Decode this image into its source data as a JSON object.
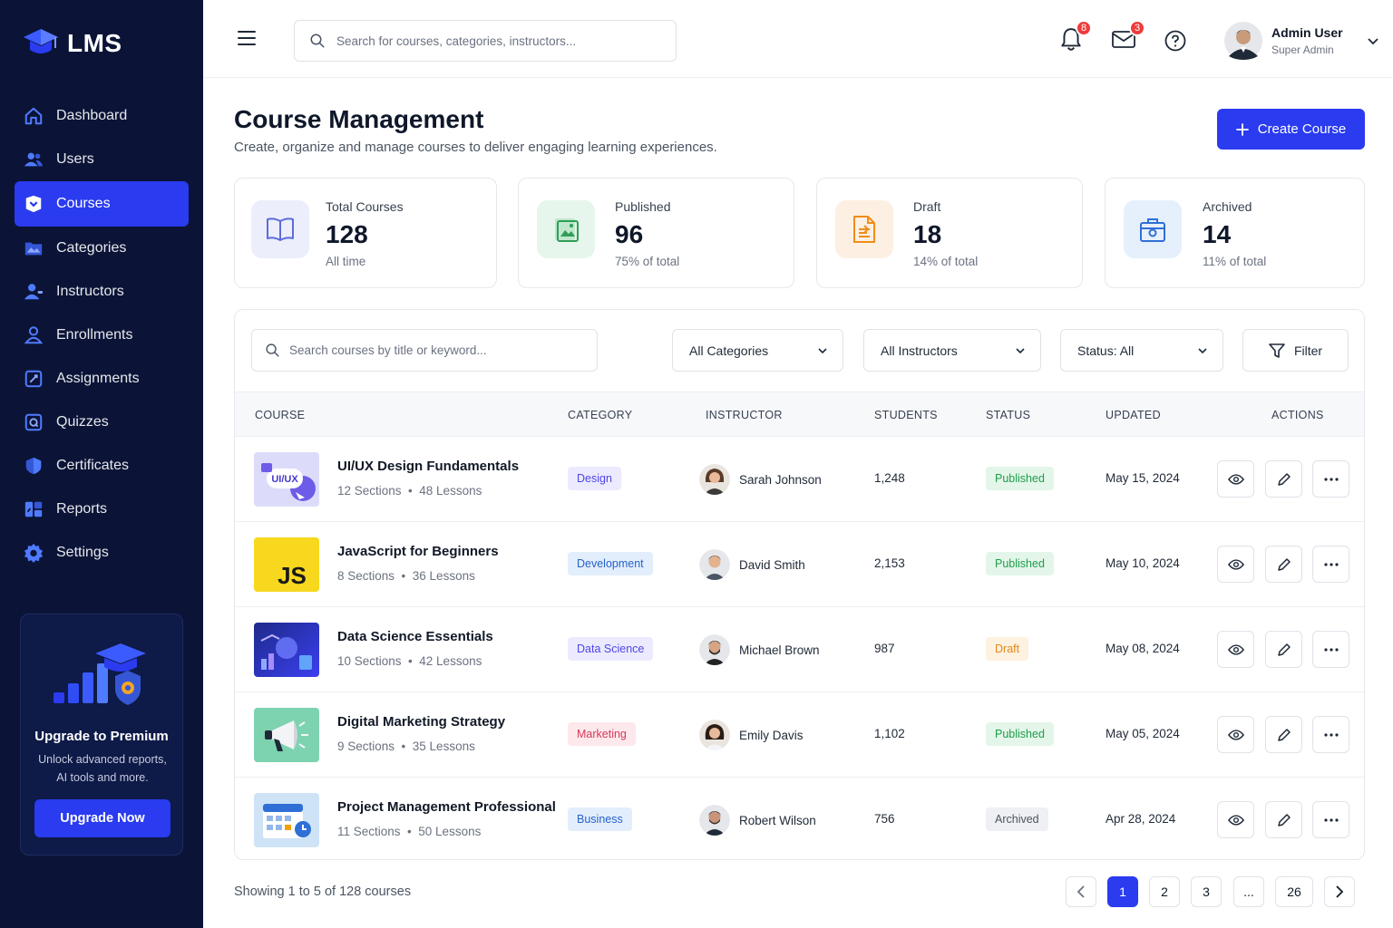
{
  "brand": {
    "name": "LMS"
  },
  "sidebar": {
    "items": [
      {
        "label": "Dashboard",
        "icon": "home-icon"
      },
      {
        "label": "Users",
        "icon": "users-icon"
      },
      {
        "label": "Courses",
        "icon": "courses-icon",
        "active": true
      },
      {
        "label": "Categories",
        "icon": "categories-icon"
      },
      {
        "label": "Instructors",
        "icon": "instructor-icon"
      },
      {
        "label": "Enrollments",
        "icon": "enrollment-icon"
      },
      {
        "label": "Assignments",
        "icon": "assignment-icon"
      },
      {
        "label": "Quizzes",
        "icon": "quiz-icon"
      },
      {
        "label": "Certificates",
        "icon": "certificate-icon"
      },
      {
        "label": "Reports",
        "icon": "reports-icon"
      },
      {
        "label": "Settings",
        "icon": "gear-icon"
      }
    ],
    "promo": {
      "title": "Upgrade to Premium",
      "description": "Unlock advanced reports, AI tools and more.",
      "button": "Upgrade Now"
    }
  },
  "header": {
    "search_placeholder": "Search for courses, categories, instructors...",
    "notifications_count": "8",
    "messages_count": "3",
    "user": {
      "name": "Admin User",
      "role": "Super Admin"
    }
  },
  "page": {
    "title": "Course Management",
    "subtitle": "Create, organize and manage courses to deliver engaging learning experiences.",
    "create_button": "Create Course"
  },
  "stats": [
    {
      "label": "Total Courses",
      "value": "128",
      "note": "All time"
    },
    {
      "label": "Published",
      "value": "96",
      "note": "75% of total"
    },
    {
      "label": "Draft",
      "value": "18",
      "note": "14% of total"
    },
    {
      "label": "Archived",
      "value": "14",
      "note": "11% of total"
    }
  ],
  "filters": {
    "search_placeholder": "Search courses by title or keyword...",
    "category": "All Categories",
    "instructor": "All Instructors",
    "status": "Status: All",
    "filter_button": "Filter"
  },
  "table": {
    "columns": [
      "COURSE",
      "CATEGORY",
      "INSTRUCTOR",
      "STUDENTS",
      "STATUS",
      "UPDATED",
      "ACTIONS"
    ],
    "rows": [
      {
        "title": "UI/UX Design Fundamentals",
        "sections": "12 Sections",
        "lessons": "48 Lessons",
        "category": "Design",
        "instructor": "Sarah Johnson",
        "students": "1,248",
        "status": "Published",
        "updated": "May 15, 2024",
        "thumb_label": "UI/UX"
      },
      {
        "title": "JavaScript for Beginners",
        "sections": "8 Sections",
        "lessons": "36 Lessons",
        "category": "Development",
        "instructor": "David Smith",
        "students": "2,153",
        "status": "Published",
        "updated": "May 10, 2024",
        "thumb_label": "JS"
      },
      {
        "title": "Data Science Essentials",
        "sections": "10 Sections",
        "lessons": "42 Lessons",
        "category": "Data Science",
        "instructor": "Michael Brown",
        "students": "987",
        "status": "Draft",
        "updated": "May 08, 2024"
      },
      {
        "title": "Digital Marketing Strategy",
        "sections": "9 Sections",
        "lessons": "35 Lessons",
        "category": "Marketing",
        "instructor": "Emily Davis",
        "students": "1,102",
        "status": "Published",
        "updated": "May 05, 2024"
      },
      {
        "title": "Project Management Professional",
        "sections": "11 Sections",
        "lessons": "50 Lessons",
        "category": "Business",
        "instructor": "Robert Wilson",
        "students": "756",
        "status": "Archived",
        "updated": "Apr 28, 2024"
      }
    ]
  },
  "pagination": {
    "summary": "Showing 1 to 5 of 128 courses",
    "pages": [
      "1",
      "2",
      "3",
      "...",
      "26"
    ]
  },
  "colors": {
    "accent": "#2a3bf0",
    "sidebar": "#0b1437"
  }
}
